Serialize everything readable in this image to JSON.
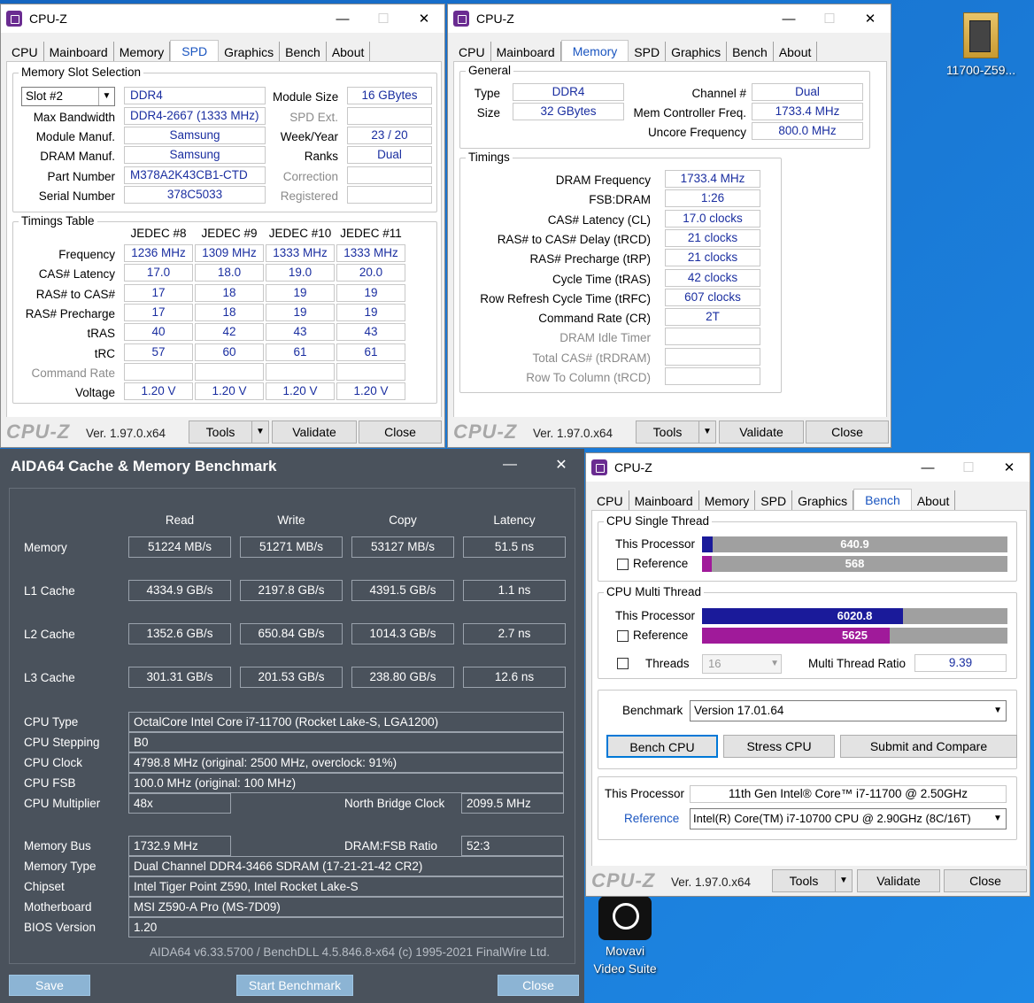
{
  "desktop": {
    "icon1_label": "11700-Z59...",
    "icon2_label_line1": "Movavi",
    "icon2_label_line2": "Video Suite"
  },
  "w1": {
    "title": "CPU-Z",
    "tabs": [
      "CPU",
      "Mainboard",
      "Memory",
      "SPD",
      "Graphics",
      "Bench",
      "About"
    ],
    "active": "SPD",
    "slot_group": "Memory Slot Selection",
    "slot": "Slot #2",
    "type": "DDR4",
    "module_size_label": "Module Size",
    "module_size": "16 GBytes",
    "max_bw_label": "Max Bandwidth",
    "max_bw": "DDR4-2667 (1333 MHz)",
    "spd_ext_label": "SPD Ext.",
    "manuf_label": "Module Manuf.",
    "manuf": "Samsung",
    "week_label": "Week/Year",
    "week": "23 / 20",
    "dram_label": "DRAM Manuf.",
    "dram": "Samsung",
    "ranks_label": "Ranks",
    "ranks": "Dual",
    "part_label": "Part Number",
    "part": "M378A2K43CB1-CTD",
    "correction_label": "Correction",
    "serial_label": "Serial Number",
    "serial": "378C5033",
    "registered_label": "Registered",
    "timings_group": "Timings Table",
    "jedec": [
      "JEDEC #8",
      "JEDEC #9",
      "JEDEC #10",
      "JEDEC #11"
    ],
    "rows": [
      {
        "label": "Frequency",
        "vals": [
          "1236 MHz",
          "1309 MHz",
          "1333 MHz",
          "1333 MHz"
        ]
      },
      {
        "label": "CAS# Latency",
        "vals": [
          "17.0",
          "18.0",
          "19.0",
          "20.0"
        ]
      },
      {
        "label": "RAS# to CAS#",
        "vals": [
          "17",
          "18",
          "19",
          "19"
        ]
      },
      {
        "label": "RAS# Precharge",
        "vals": [
          "17",
          "18",
          "19",
          "19"
        ]
      },
      {
        "label": "tRAS",
        "vals": [
          "40",
          "42",
          "43",
          "43"
        ]
      },
      {
        "label": "tRC",
        "vals": [
          "57",
          "60",
          "61",
          "61"
        ]
      },
      {
        "label": "Command Rate",
        "vals": [
          "",
          "",
          "",
          ""
        ]
      },
      {
        "label": "Voltage",
        "vals": [
          "1.20 V",
          "1.20 V",
          "1.20 V",
          "1.20 V"
        ]
      }
    ],
    "logo": "CPU-Z",
    "version": "Ver. 1.97.0.x64",
    "tools": "Tools",
    "validate": "Validate",
    "close": "Close"
  },
  "w2": {
    "title": "CPU-Z",
    "active": "Memory",
    "general": "General",
    "type_label": "Type",
    "type": "DDR4",
    "size_label": "Size",
    "size": "32 GBytes",
    "channel_label": "Channel #",
    "channel": "Dual",
    "mcf_label": "Mem Controller Freq.",
    "mcf": "1733.4 MHz",
    "uncore_label": "Uncore Frequency",
    "uncore": "800.0 MHz",
    "timings": "Timings",
    "trows": [
      {
        "label": "DRAM Frequency",
        "val": "1733.4 MHz",
        "gray": false
      },
      {
        "label": "FSB:DRAM",
        "val": "1:26",
        "gray": false
      },
      {
        "label": "CAS# Latency (CL)",
        "val": "17.0 clocks",
        "gray": false
      },
      {
        "label": "RAS# to CAS# Delay (tRCD)",
        "val": "21 clocks",
        "gray": false
      },
      {
        "label": "RAS# Precharge (tRP)",
        "val": "21 clocks",
        "gray": false
      },
      {
        "label": "Cycle Time (tRAS)",
        "val": "42 clocks",
        "gray": false
      },
      {
        "label": "Row Refresh Cycle Time (tRFC)",
        "val": "607 clocks",
        "gray": false
      },
      {
        "label": "Command Rate (CR)",
        "val": "2T",
        "gray": false
      },
      {
        "label": "DRAM Idle Timer",
        "val": "",
        "gray": true
      },
      {
        "label": "Total CAS# (tRDRAM)",
        "val": "",
        "gray": true
      },
      {
        "label": "Row To Column (tRCD)",
        "val": "",
        "gray": true
      }
    ]
  },
  "w3": {
    "title": "CPU-Z",
    "active": "Bench",
    "single": "CPU Single Thread",
    "multi": "CPU Multi Thread",
    "this_proc": "This Processor",
    "reference": "Reference",
    "st_this": "640.9",
    "st_this_frac": 0.036,
    "st_ref": "568",
    "st_ref_frac": 0.032,
    "mt_this": "6020.8",
    "mt_this_frac": 0.657,
    "mt_ref": "5625",
    "mt_ref_frac": 0.614,
    "threads_label": "Threads",
    "threads": "16",
    "mtr_label": "Multi Thread Ratio",
    "mtr": "9.39",
    "bench_label": "Benchmark",
    "bench_ver": "Version 17.01.64",
    "bench_cpu": "Bench CPU",
    "stress_cpu": "Stress CPU",
    "submit": "Submit and Compare",
    "this_proc_label": "This Processor",
    "this_proc_name": "11th Gen Intel® Core™ i7-11700 @ 2.50GHz",
    "ref_label": "Reference",
    "ref_name": "Intel(R) Core(TM) i7-10700 CPU @ 2.90GHz (8C/16T)",
    "colors": {
      "this": "#1a1a9a",
      "ref": "#a01a9a"
    }
  },
  "aida": {
    "title": "AIDA64 Cache & Memory Benchmark",
    "cols": [
      "Read",
      "Write",
      "Copy",
      "Latency"
    ],
    "rows": [
      {
        "label": "Memory",
        "vals": [
          "51224 MB/s",
          "51271 MB/s",
          "53127 MB/s",
          "51.5 ns"
        ]
      },
      {
        "label": "L1 Cache",
        "vals": [
          "4334.9 GB/s",
          "2197.8 GB/s",
          "4391.5 GB/s",
          "1.1 ns"
        ]
      },
      {
        "label": "L2 Cache",
        "vals": [
          "1352.6 GB/s",
          "650.84 GB/s",
          "1014.3 GB/s",
          "2.7 ns"
        ]
      },
      {
        "label": "L3 Cache",
        "vals": [
          "301.31 GB/s",
          "201.53 GB/s",
          "238.80 GB/s",
          "12.6 ns"
        ]
      }
    ],
    "cpu_type_label": "CPU Type",
    "cpu_type": "OctalCore Intel Core i7-11700  (Rocket Lake-S, LGA1200)",
    "stepping_label": "CPU Stepping",
    "stepping": "B0",
    "clock_label": "CPU Clock",
    "clock": "4798.8 MHz  (original: 2500 MHz, overclock: 91%)",
    "fsb_label": "CPU FSB",
    "fsb": "100.0 MHz  (original: 100 MHz)",
    "mult_label": "CPU Multiplier",
    "mult": "48x",
    "nb_label": "North Bridge Clock",
    "nb": "2099.5 MHz",
    "membus_label": "Memory Bus",
    "membus": "1732.9 MHz",
    "ratio_label": "DRAM:FSB Ratio",
    "ratio": "52:3",
    "memtype_label": "Memory Type",
    "memtype": "Dual Channel DDR4-3466 SDRAM  (17-21-21-42 CR2)",
    "chipset_label": "Chipset",
    "chipset": "Intel Tiger Point Z590, Intel Rocket Lake-S",
    "mb_label": "Motherboard",
    "mb": "MSI Z590-A Pro (MS-7D09)",
    "bios_label": "BIOS Version",
    "bios": "1.20",
    "footer": "AIDA64 v6.33.5700 / BenchDLL 4.5.846.8-x64  (c) 1995-2021 FinalWire Ltd.",
    "save": "Save",
    "start": "Start Benchmark",
    "close": "Close"
  }
}
